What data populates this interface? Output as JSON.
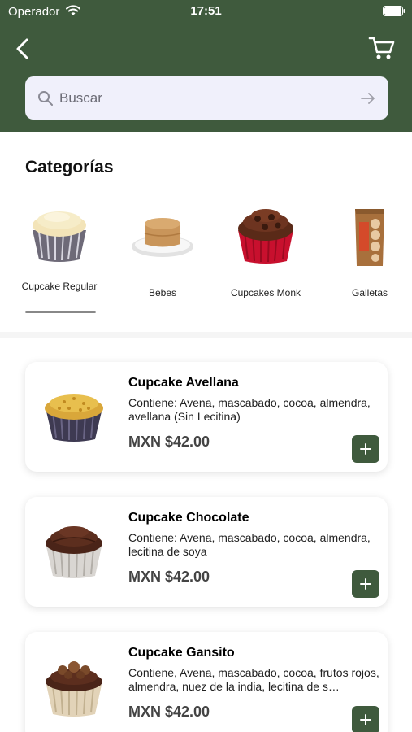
{
  "status_bar": {
    "carrier": "Operador",
    "time": "17:51"
  },
  "search": {
    "placeholder": "Buscar"
  },
  "categories_title": "Categorías",
  "categories": [
    {
      "label": "Cupcake Regular",
      "icon": "vanilla-cupcake"
    },
    {
      "label": "Bebes",
      "icon": "small-cake"
    },
    {
      "label": "Cupcakes Monk",
      "icon": "chocolate-cupcake"
    },
    {
      "label": "Galletas",
      "icon": "cookie-bag"
    }
  ],
  "products": [
    {
      "name": "Cupcake Avellana",
      "description": "Contiene: Avena, mascabado, cocoa, almendra, avellana (Sin Lecitina)",
      "price": "MXN $42.00",
      "icon": "hazelnut-cupcake"
    },
    {
      "name": "Cupcake Chocolate",
      "description": "Contiene: Avena, mascabado, cocoa, almendra, lecitina de soya",
      "price": "MXN $42.00",
      "icon": "chocolate-cupcake"
    },
    {
      "name": "Cupcake Gansito",
      "description": "Contiene, Avena, mascabado, cocoa, frutos rojos, almendra, nuez de la india, lecitina de s…",
      "price": "MXN $42.00",
      "icon": "gansito-cupcake"
    }
  ],
  "colors": {
    "header": "#3f5a3d",
    "accent": "#3f5a3d",
    "search_bg": "#f0f0fb"
  }
}
